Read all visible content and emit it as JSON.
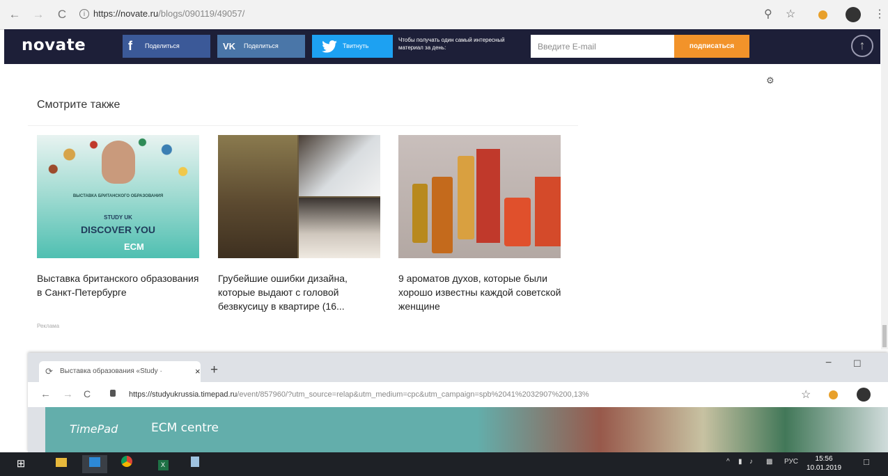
{
  "browser": {
    "url_host": "https://novate.ru",
    "url_path": "/blogs/090119/49057/"
  },
  "site": {
    "logo": "novate",
    "share_buttons": [
      {
        "label": "Поделиться",
        "network": "facebook",
        "color": "#3b5998",
        "icon": "f"
      },
      {
        "label": "Поделиться",
        "network": "vk",
        "color": "#4a76a8",
        "icon": "VK"
      },
      {
        "label": "Твитнуть",
        "network": "twitter",
        "color": "#1da1f2",
        "icon": "bird"
      }
    ],
    "promo_text": "Чтобы получать один самый интересный материал за день:",
    "email_placeholder": "Введите E-mail",
    "subscribe_label": "подписаться",
    "accent_color": "#f2932a",
    "header_bg": "#1d1f38"
  },
  "main": {
    "section_title": "Смотрите также",
    "cards": [
      {
        "title": "Выставка британского образования в Санкт-Петербурге",
        "source": "Реклама",
        "ad_text_1": "ВЫСТАВКА БРИТАНСКОГО ОБРАЗОВАНИЯ",
        "ad_text_2": "STUDY UK",
        "ad_text_3": "DISCOVER YOU",
        "ad_brand": "ECM"
      },
      {
        "title": "Грубейшие ошибки дизайна, которые выдают с головой безвкусицу в квартире (16..."
      },
      {
        "title": "9 ароматов духов, которые были хорошо известны каждой советской женщине"
      }
    ]
  },
  "second_window": {
    "tab_title": "Выставка образования «Study ·",
    "url_host": "https://studyukrussia.timepad.ru",
    "url_path": "/event/857960/?utm_source=relap&utm_medium=cpc&utm_campaign=spb%2041%2032907%200,13%",
    "banner_logo": "TimePad",
    "banner_title": "ECM centre"
  },
  "taskbar": {
    "language": "РУС",
    "time": "15:56",
    "date": "10.01.2019"
  }
}
